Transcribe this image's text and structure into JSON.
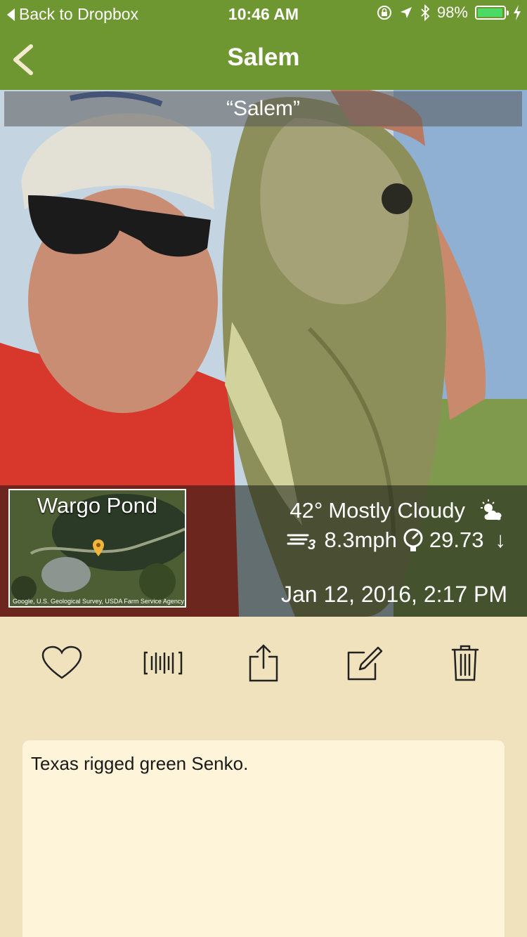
{
  "status_bar": {
    "back_label": "Back to Dropbox",
    "time": "10:46 AM",
    "battery_percent": "98%",
    "battery_level": 0.98,
    "icons": [
      "orientation-lock-icon",
      "location-arrow-icon",
      "bluetooth-icon",
      "battery-icon",
      "charging-bolt-icon"
    ]
  },
  "nav": {
    "title": "Salem",
    "back_icon": "chevron-left-icon"
  },
  "photo": {
    "caption": "“Salem”",
    "location_name": "Wargo Pond",
    "map_credit": "Google, U.S. Geological Survey, USDA Farm Service Agency",
    "temperature": "42°",
    "conditions": "Mostly Cloudy",
    "wind": "8.3mph",
    "pressure": "29.73",
    "pressure_trend": "↓",
    "datetime": "Jan 12, 2016, 2:17 PM"
  },
  "actions": [
    {
      "name": "favorite-button",
      "icon": "heart-icon"
    },
    {
      "name": "measure-button",
      "icon": "ruler-icon"
    },
    {
      "name": "share-button",
      "icon": "share-icon"
    },
    {
      "name": "edit-button",
      "icon": "edit-icon"
    },
    {
      "name": "delete-button",
      "icon": "trash-icon"
    }
  ],
  "notes": {
    "text": "Texas rigged green Senko."
  },
  "colors": {
    "nav_green": "#6e9731",
    "background": "#efe2bd",
    "notes_bg": "#fef4d9"
  }
}
